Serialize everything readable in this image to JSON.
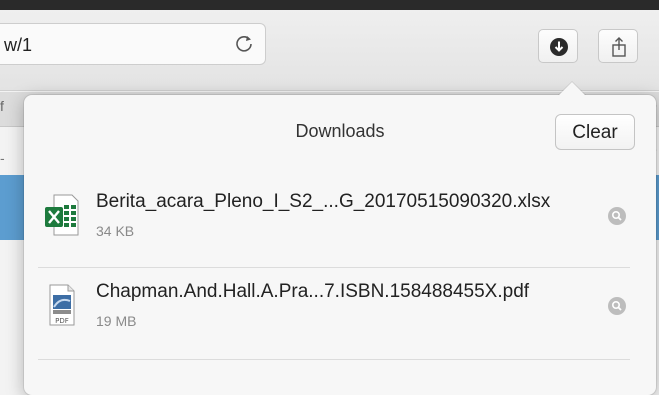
{
  "browser": {
    "url_fragment": "w/1",
    "tab_fragment": "f",
    "tab_more": "›"
  },
  "popover": {
    "title": "Downloads",
    "clear_label": "Clear"
  },
  "downloads": [
    {
      "name": "Berita_acara_Pleno_I_S2_...G_20170515090320.xlsx",
      "size": "34 KB",
      "icon": "excel-file-icon"
    },
    {
      "name": "Chapman.And.Hall.A.Pra...7.ISBN.158488455X.pdf",
      "size": "19 MB",
      "icon": "pdf-file-icon"
    }
  ],
  "colors": {
    "accent_blue": "#5c9dd0",
    "excel_green": "#1d7a3d",
    "pdf_blue": "#3d6ea5"
  }
}
